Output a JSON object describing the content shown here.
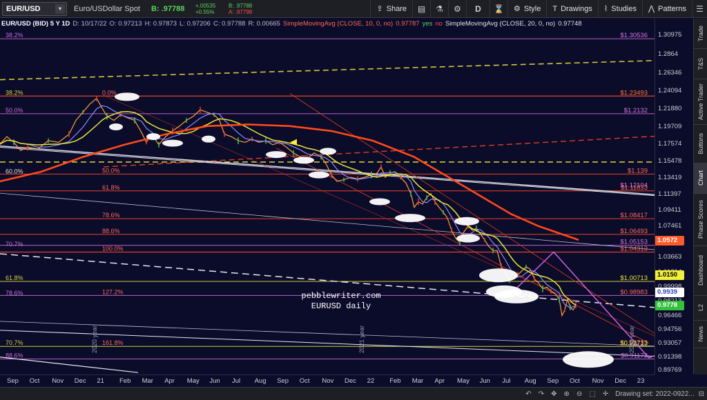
{
  "toolbar": {
    "symbol": "EUR/USD",
    "description": "Euro/USDollar Spot",
    "bid_label": "B: .97788",
    "change": "+.00535",
    "change_pct": "+0.55%",
    "bid_small": "B: .97788",
    "ask_small": "A: .97798",
    "share_label": "Share",
    "period_label": "D",
    "style_label": "Style",
    "drawings_label": "Drawings",
    "studies_label": "Studies",
    "patterns_label": "Patterns"
  },
  "legend": {
    "title": "EUR/USD (BID) 5 Y 1D",
    "d_lbl": "D: 10/17/22",
    "o_lbl": "O: 0.97213",
    "h_lbl": "H: 0.97873",
    "l_lbl": "L: 0.97206",
    "c_lbl": "C: 0.97788",
    "r_lbl": "R: 0.00665",
    "sma10": "SimpleMovingAvg (CLOSE, 10, 0, no)",
    "sma10_val": "0.97787",
    "yes": "yes",
    "no": "no",
    "sma20": "SimpleMovingAvg (CLOSE, 20, 0, no)",
    "sma20_val": "0.97748"
  },
  "watermark": {
    "line1": "pebblewriter.com",
    "line2": "EURUSD daily"
  },
  "fib_left": [
    {
      "label": "38.2%",
      "price": 1.3053,
      "color": "#c86fd8"
    },
    {
      "label": "38.2%",
      "price": 1.2349,
      "color": "#d4d43a"
    },
    {
      "label": "50.0%",
      "price": 1.2132,
      "color": "#c86fd8"
    },
    {
      "label": "60.0%",
      "price": 1.1382,
      "color": "#e0e0e0"
    },
    {
      "label": "70.7%",
      "price": 1.0487,
      "color": "#c86fd8"
    },
    {
      "label": "61.8%",
      "price": 1.0071,
      "color": "#d4d43a"
    },
    {
      "label": "78.6%",
      "price": 0.9886,
      "color": "#c86fd8"
    },
    {
      "label": "70.7%",
      "price": 0.9272,
      "color": "#d4d43a"
    },
    {
      "label": "88.6%",
      "price": 0.9117,
      "color": "#c86fd8"
    }
  ],
  "fib_mid": [
    {
      "label": "0.0%",
      "price": 1.2349
    },
    {
      "label": "50.0%",
      "price": 1.139
    },
    {
      "label": "61.8%",
      "price": 1.1183
    },
    {
      "label": "78.6%",
      "price": 1.0841
    },
    {
      "label": "88.6%",
      "price": 1.0649
    },
    {
      "label": "100.0%",
      "price": 1.0431
    },
    {
      "label": "127.2%",
      "price": 0.9898
    },
    {
      "label": "161.8%",
      "price": 0.9272
    }
  ],
  "price_labels_right": [
    {
      "text": "$1.30536",
      "price": 1.3053,
      "color": "#d27adf"
    },
    {
      "text": "$1.23493",
      "price": 1.2349,
      "color": "#ff7a3a"
    },
    {
      "text": "$1.2132",
      "price": 1.2132,
      "color": "#d27adf"
    },
    {
      "text": "$1.139",
      "price": 1.139,
      "color": "#ff6b5a"
    },
    {
      "text": "$1.12104",
      "price": 1.121,
      "color": "#d27adf"
    },
    {
      "text": "$1.11833",
      "price": 1.1183,
      "color": "#ff6b5a"
    },
    {
      "text": "$1.08417",
      "price": 1.0841,
      "color": "#ff6b5a"
    },
    {
      "text": "$1.06493",
      "price": 1.0649,
      "color": "#ff6b5a"
    },
    {
      "text": "$1.05153",
      "price": 1.0515,
      "color": "#d27adf"
    },
    {
      "text": "$1.04313",
      "price": 1.0431,
      "color": "#ff6b5a"
    },
    {
      "text": "$1.00713",
      "price": 1.0071,
      "color": "#e8e83a"
    },
    {
      "text": "$0.98983",
      "price": 0.9898,
      "color": "#ff6b5a"
    },
    {
      "text": "$0.92733",
      "price": 0.9273,
      "color": "#ff6b5a"
    },
    {
      "text": "$0.92713",
      "price": 0.9271,
      "color": "#e8e83a"
    },
    {
      "text": "$0.91173",
      "price": 0.9117,
      "color": "#d27adf"
    }
  ],
  "axis_ticks": [
    "1.30975",
    "1.2864",
    "1.26346",
    "1.24094",
    "1.21880",
    "1.19709",
    "1.17574",
    "1.15478",
    "1.13419",
    "1.11397",
    "1.09411",
    "1.07461",
    "1.05546",
    "1.03663",
    "1.01814",
    "0.99998",
    "0.98213",
    "0.96466",
    "0.94756",
    "0.93057",
    "0.91398",
    "0.89769"
  ],
  "axis_badges": [
    {
      "text": "1.0572",
      "price": 1.0572,
      "bg": "#ff5a2a",
      "fg": "#ffffff"
    },
    {
      "text": "1.0150",
      "price": 1.015,
      "bg": "#f0f03a",
      "fg": "#000000"
    },
    {
      "text": "0.9939",
      "price": 0.9939,
      "bg": "#ffffff",
      "fg": "#3040c0"
    },
    {
      "text": "0.9778",
      "price": 0.9778,
      "bg": "#33c03a",
      "fg": "#ffffff"
    }
  ],
  "time_labels": [
    "Sep",
    "Oct",
    "Nov",
    "Dec",
    "21",
    "Feb",
    "Mar",
    "Apr",
    "May",
    "Jun",
    "Jul",
    "Aug",
    "Sep",
    "Oct",
    "Nov",
    "Dec",
    "22",
    "Feb",
    "Mar",
    "Apr",
    "May",
    "Jun",
    "Jul",
    "Aug",
    "Sep",
    "Oct",
    "Nov",
    "Dec",
    "23"
  ],
  "year_marks": [
    "2020 year",
    "2021 year",
    "2022 year"
  ],
  "sidebar": [
    "Trade",
    "T&S",
    "Active Trader",
    "Buttons",
    "Chart",
    "Phase Scores",
    "Dashboard",
    "L2",
    "News"
  ],
  "status": {
    "drawing_set": "Drawing set: 2022-0922..."
  },
  "colors": {
    "background": "#0b0b2a",
    "sma10": "#8c8cff",
    "sma20": "#e8e83a",
    "sma_long": "#ff4a1a",
    "price": "#ffa040"
  }
}
